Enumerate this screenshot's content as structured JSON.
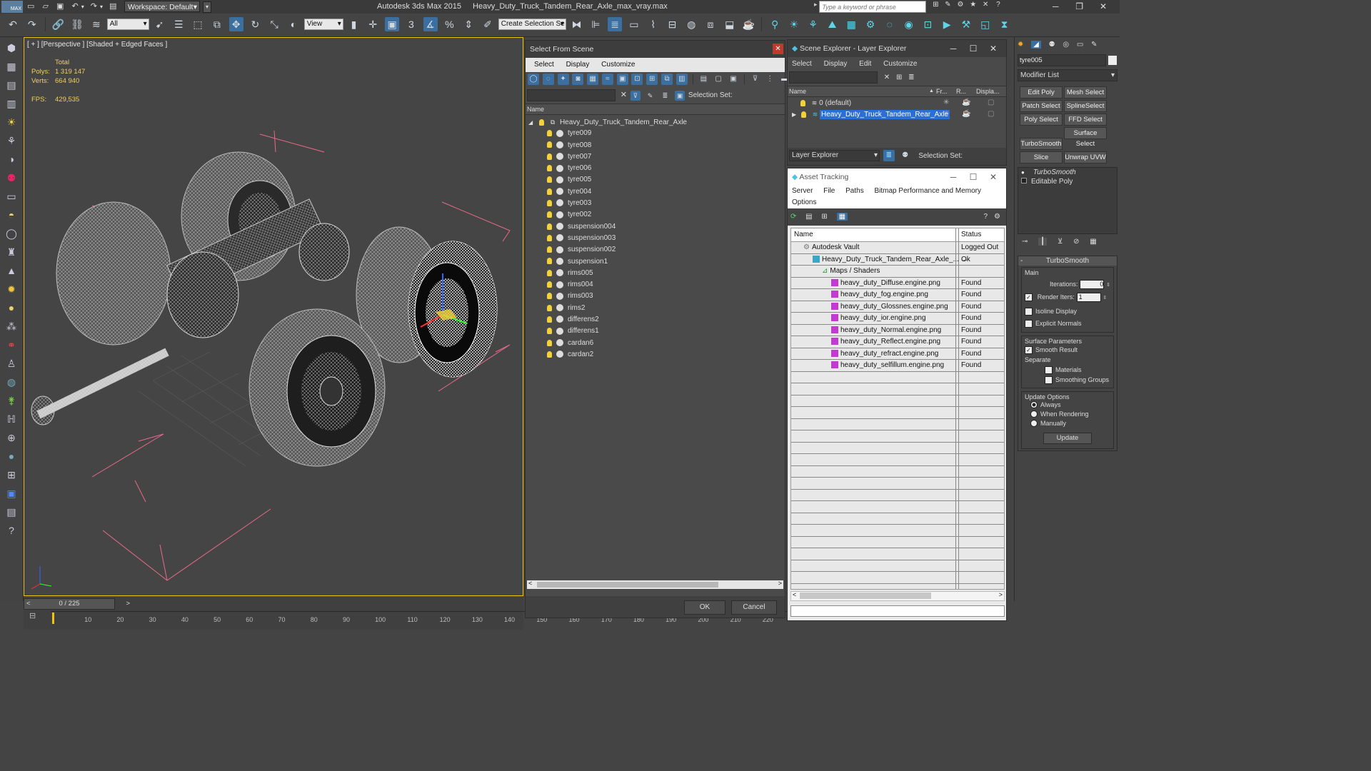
{
  "app": {
    "title": "Autodesk 3ds Max  2015",
    "filename": "Heavy_Duty_Truck_Tandem_Rear_Axle_max_vray.max",
    "workspace": "Workspace: Default",
    "search_placeholder": "Type a keyword or phrase",
    "logo": "MAX"
  },
  "toolbar": {
    "filter_value": "All",
    "view_value": "View",
    "selection_set_value": "Create Selection Se"
  },
  "viewport": {
    "label": "[ + ] [Perspective ] [Shaded + Edged Faces ]",
    "stats": {
      "total_label": "Total",
      "polys_label": "Polys:",
      "polys_value": "1 319 147",
      "verts_label": "Verts:",
      "verts_value": "664 940",
      "fps_label": "FPS:",
      "fps_value": "429,535"
    }
  },
  "timeline": {
    "frame_counter": "0 / 225",
    "ticks": [
      "10",
      "20",
      "30",
      "40",
      "50",
      "60",
      "70",
      "80",
      "90",
      "100",
      "110",
      "120",
      "130",
      "140",
      "150",
      "160",
      "170",
      "180",
      "190",
      "200",
      "210",
      "220"
    ]
  },
  "select_from_scene": {
    "title": "Select From Scene",
    "menu": [
      "Select",
      "Display",
      "Customize"
    ],
    "selection_set_label": "Selection Set:",
    "column_name": "Name",
    "root": "Heavy_Duty_Truck_Tandem_Rear_Axle",
    "items": [
      "tyre009",
      "tyre008",
      "tyre007",
      "tyre006",
      "tyre005",
      "tyre004",
      "tyre003",
      "tyre002",
      "suspension004",
      "suspension003",
      "suspension002",
      "suspension1",
      "rims005",
      "rims004",
      "rims003",
      "rims2",
      "differens2",
      "differens1",
      "cardan6",
      "cardan2"
    ],
    "ok_label": "OK",
    "cancel_label": "Cancel"
  },
  "scene_explorer": {
    "title": "Scene Explorer - Layer Explorer",
    "menu": [
      "Select",
      "Display",
      "Edit",
      "Customize"
    ],
    "columns": [
      "Name",
      "Fr...",
      "R...",
      "Displa..."
    ],
    "layers": [
      "0 (default)",
      "Heavy_Duty_Truck_Tandem_Rear_Axle"
    ],
    "footer_dropdown": "Layer Explorer",
    "selection_set_label": "Selection Set:"
  },
  "asset_tracking": {
    "title": "Asset Tracking",
    "menu": [
      "Server",
      "File",
      "Paths",
      "Bitmap Performance and Memory",
      "Options"
    ],
    "columns": [
      "Name",
      "Status"
    ],
    "rows": [
      {
        "name": "Autodesk Vault",
        "status": "Logged Out ...",
        "indent": 1,
        "kind": "vault"
      },
      {
        "name": "Heavy_Duty_Truck_Tandem_Rear_Axle_...",
        "status": "Ok",
        "indent": 2,
        "kind": "max"
      },
      {
        "name": "Maps / Shaders",
        "status": "",
        "indent": 3,
        "kind": "folder"
      },
      {
        "name": "heavy_duty_Diffuse.engine.png",
        "status": "Found",
        "indent": 4,
        "kind": "png"
      },
      {
        "name": "heavy_duty_fog.engine.png",
        "status": "Found",
        "indent": 4,
        "kind": "png"
      },
      {
        "name": "heavy_duty_Glossnes.engine.png",
        "status": "Found",
        "indent": 4,
        "kind": "png"
      },
      {
        "name": "heavy_duty_ior.engine.png",
        "status": "Found",
        "indent": 4,
        "kind": "png"
      },
      {
        "name": "heavy_duty_Normal.engine.png",
        "status": "Found",
        "indent": 4,
        "kind": "png"
      },
      {
        "name": "heavy_duty_Reflect.engine.png",
        "status": "Found",
        "indent": 4,
        "kind": "png"
      },
      {
        "name": "heavy_duty_refract.engine.png",
        "status": "Found",
        "indent": 4,
        "kind": "png"
      },
      {
        "name": "heavy_duty_selfillum.engine.png",
        "status": "Found",
        "indent": 4,
        "kind": "png"
      }
    ]
  },
  "command_panel": {
    "object_name": "tyre005",
    "modifier_list": "Modifier List",
    "modifier_buttons": [
      "Edit Poly",
      "Mesh Select",
      "Patch Select",
      "SplineSelect",
      "Poly Select",
      "FFD Select",
      "TurboSmooth",
      "Surface Select",
      "Slice",
      "Unwrap UVW"
    ],
    "stack": [
      "TurboSmooth",
      "Editable Poly"
    ],
    "rollout_title": "TurboSmooth",
    "main_label": "Main",
    "iterations_label": "Iterations:",
    "iterations_value": "0",
    "render_iters_label": "Render Iters:",
    "render_iters_value": "1",
    "isoline_label": "Isoline Display",
    "explicit_normals_label": "Explicit Normals",
    "surface_params_label": "Surface Parameters",
    "smooth_result_label": "Smooth Result",
    "separate_label": "Separate",
    "materials_label": "Materials",
    "smoothing_groups_label": "Smoothing Groups",
    "update_options_label": "Update Options",
    "always_label": "Always",
    "when_rendering_label": "When Rendering",
    "manually_label": "Manually",
    "update_button": "Update"
  },
  "colors": {
    "accent": "#3b6fa0",
    "selection": "#2a6fd6",
    "bulb": "#f2d13a"
  }
}
